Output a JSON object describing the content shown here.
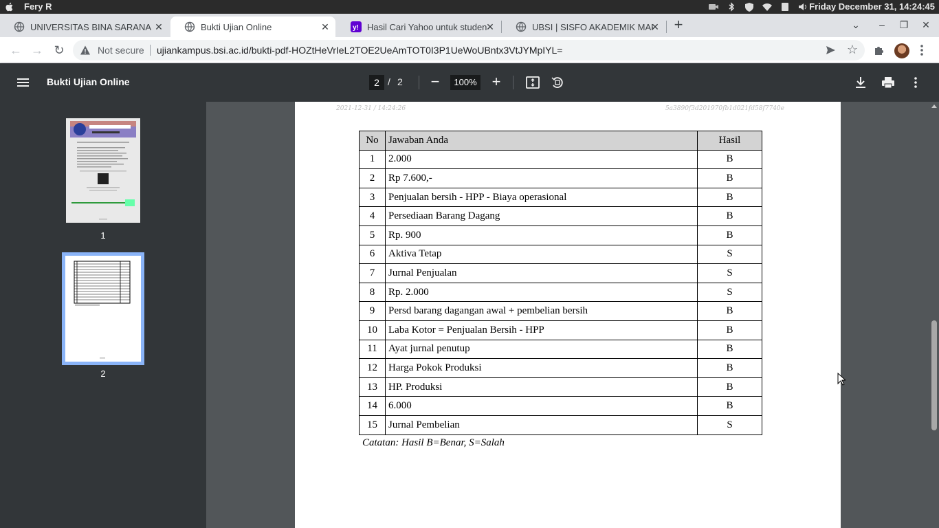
{
  "os": {
    "user": "Fery R",
    "clock": "Friday December 31, 14:24:45",
    "tray_icons": [
      "camera-icon",
      "bluetooth-icon",
      "shield-icon",
      "wifi-icon",
      "clipboard-icon",
      "volume-icon"
    ]
  },
  "browser": {
    "tabs": [
      {
        "title": "UNIVERSITAS BINA SARANA IN",
        "icon": "globe-icon",
        "active": false
      },
      {
        "title": "Bukti Ujian Online",
        "icon": "globe-icon",
        "active": true
      },
      {
        "title": "Hasil Cari Yahoo untuk studen",
        "icon": "yahoo-icon",
        "active": false
      },
      {
        "title": "UBSI | SISFO AKADEMIK MAHA",
        "icon": "globe-icon",
        "active": false
      }
    ],
    "not_secure_label": "Not secure",
    "url": "ujiankampus.bsi.ac.id/bukti-pdf-HOZtHeVrIeL2TOE2UeAmTOT0I3P1UeWoUBntx3VtJYMpIYL="
  },
  "pdf": {
    "title": "Bukti Ujian Online",
    "current_page": "2",
    "page_separator": "/",
    "total_pages": "2",
    "zoom": "100%",
    "thumbnails": [
      {
        "label": "1",
        "selected": false
      },
      {
        "label": "2",
        "selected": true
      }
    ]
  },
  "document": {
    "header_date": "2021-12-31 / 14:24:26",
    "header_hash": "5a3890f3d201970fb1d021fd58f7740e",
    "table": {
      "headers": [
        "No",
        "Jawaban Anda",
        "Hasil"
      ],
      "rows": [
        [
          "1",
          "2.000",
          "B"
        ],
        [
          "2",
          "Rp 7.600,-",
          "B"
        ],
        [
          "3",
          "Penjualan bersih - HPP - Biaya operasional",
          "B"
        ],
        [
          "4",
          "Persediaan Barang Dagang",
          "B"
        ],
        [
          "5",
          "Rp. 900",
          "B"
        ],
        [
          "6",
          "Aktiva Tetap",
          "S"
        ],
        [
          "7",
          "Jurnal Penjualan",
          "S"
        ],
        [
          "8",
          "Rp. 2.000",
          "S"
        ],
        [
          "9",
          "Persd barang dagangan awal + pembelian bersih",
          "B"
        ],
        [
          "10",
          "Laba Kotor = Penjualan Bersih - HPP",
          "B"
        ],
        [
          "11",
          "Ayat jurnal penutup",
          "B"
        ],
        [
          "12",
          "Harga Pokok Produksi",
          "B"
        ],
        [
          "13",
          "HP. Produksi",
          "B"
        ],
        [
          "14",
          "6.000",
          "B"
        ],
        [
          "15",
          "Jurnal Pembelian",
          "S"
        ]
      ]
    },
    "note": "Catatan: Hasil B=Benar, S=Salah"
  },
  "colors": {
    "os_bar": "#2b2b2b",
    "tab_strip": "#dfe1e5",
    "pdf_toolbar": "#323639",
    "viewer_bg": "#525659",
    "thumbnail_highlight": "#8ab4f8",
    "table_header_bg": "#d3d3d3"
  }
}
